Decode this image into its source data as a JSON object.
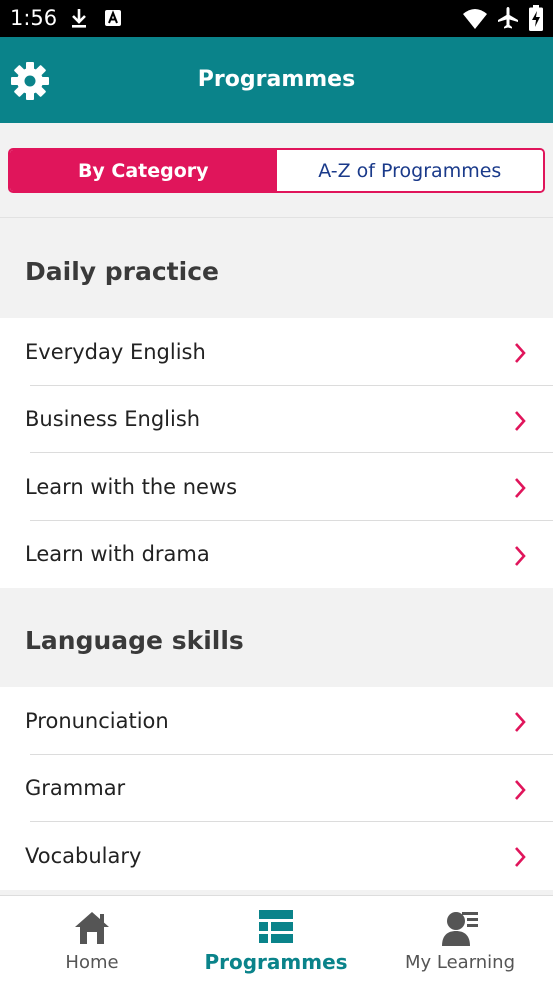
{
  "status_bar": {
    "time": "1:56",
    "icons": [
      "download-icon",
      "a-notification-icon",
      "wifi-icon",
      "airplane-icon",
      "battery-charging-icon"
    ]
  },
  "app_bar": {
    "title": "Programmes",
    "settings_icon": "gear-icon"
  },
  "segmented_control": {
    "by_category": "By Category",
    "a_z": "A-Z of Programmes",
    "selected": "By Category"
  },
  "sections": [
    {
      "title": "Daily practice",
      "items": [
        "Everyday English",
        "Business English",
        "Learn with the news",
        "Learn with drama"
      ]
    },
    {
      "title": "Language skills",
      "items": [
        "Pronunciation",
        "Grammar",
        "Vocabulary"
      ]
    }
  ],
  "bottom_nav": {
    "items": [
      {
        "label": "Home",
        "icon": "home-icon"
      },
      {
        "label": "Programmes",
        "icon": "list-grid-icon"
      },
      {
        "label": "My Learning",
        "icon": "learner-icon"
      }
    ],
    "active": "Programmes"
  },
  "colors": {
    "app_bar": "#0a838a",
    "accent": "#e0155b",
    "link_blue": "#1a3a8a",
    "chevron": "#e0155b"
  }
}
